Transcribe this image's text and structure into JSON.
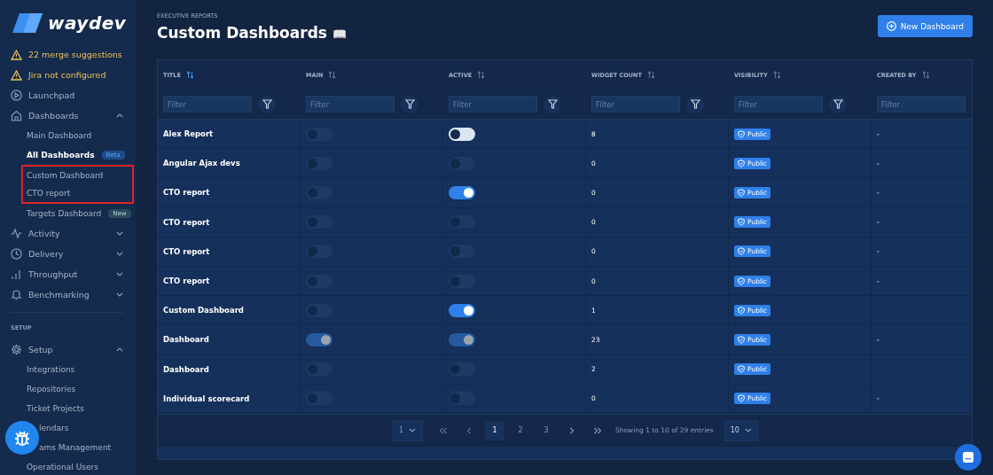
{
  "sidebar": {
    "logo": "waydev",
    "alerts": [
      {
        "label": "22 merge suggestions"
      },
      {
        "label": "Jira not configured"
      }
    ],
    "items": [
      {
        "label": "Launchpad"
      },
      {
        "label": "Dashboards",
        "expanded": true,
        "children": [
          {
            "label": "Main Dashboard",
            "selected": false,
            "highlighted": false
          },
          {
            "label": "All Dashboards",
            "selected": true,
            "highlighted": false,
            "badge": "Beta"
          },
          {
            "label": "Custom Dashboard",
            "selected": false,
            "highlighted": true
          },
          {
            "label": "CTO report",
            "selected": false,
            "highlighted": true
          },
          {
            "label": "Targets Dashboard",
            "selected": false,
            "highlighted": false,
            "badge": "New"
          }
        ]
      },
      {
        "label": "Activity",
        "expanded": false
      },
      {
        "label": "Delivery",
        "expanded": false
      },
      {
        "label": "Throughput",
        "expanded": false
      },
      {
        "label": "Benchmarking",
        "expanded": false
      }
    ],
    "section": "SETUP",
    "setup": {
      "label": "Setup",
      "expanded": true,
      "children": [
        {
          "label": "Integrations",
          "covered": false
        },
        {
          "label": "Repositories",
          "covered": false
        },
        {
          "label": "Ticket Projects",
          "covered": false
        },
        {
          "label": "lendars",
          "covered": true
        },
        {
          "label": "ams Management",
          "covered": true
        },
        {
          "label": "Operational Users",
          "covered": false
        }
      ]
    }
  },
  "header": {
    "breadcrumb": "EXECUTIVE REPORTS",
    "title": "Custom Dashboards",
    "title_emoji": "📖",
    "button": "New Dashboard"
  },
  "table": {
    "columns": [
      {
        "label": "TITLE",
        "sorted": true,
        "filter_placeholder": "Filter"
      },
      {
        "label": "MAIN",
        "sorted": false,
        "filter_placeholder": "Filter"
      },
      {
        "label": "ACTIVE",
        "sorted": false,
        "filter_placeholder": "Filter"
      },
      {
        "label": "WIDGET COUNT",
        "sorted": false,
        "filter_placeholder": "Filter"
      },
      {
        "label": "VISIBILITY",
        "sorted": false,
        "filter_placeholder": "Filter"
      },
      {
        "label": "CREATED BY",
        "sorted": false,
        "filter_placeholder": "Filter"
      }
    ],
    "rows": [
      {
        "title": "Alex Report",
        "main": {
          "on": false,
          "disabled": false,
          "focused": false
        },
        "active": {
          "on": false,
          "disabled": false,
          "focused": true
        },
        "widget_count": "8",
        "visibility": "Public",
        "created_by": "-"
      },
      {
        "title": "Angular Ajax devs",
        "main": {
          "on": false,
          "disabled": false,
          "focused": false
        },
        "active": {
          "on": false,
          "disabled": false,
          "focused": false
        },
        "widget_count": "0",
        "visibility": "Public",
        "created_by": "-"
      },
      {
        "title": "CTO report",
        "main": {
          "on": false,
          "disabled": false,
          "focused": false
        },
        "active": {
          "on": true,
          "disabled": false,
          "focused": false
        },
        "widget_count": "0",
        "visibility": "Public",
        "created_by": "-"
      },
      {
        "title": "CTO report",
        "main": {
          "on": false,
          "disabled": false,
          "focused": false
        },
        "active": {
          "on": false,
          "disabled": false,
          "focused": false
        },
        "widget_count": "0",
        "visibility": "Public",
        "created_by": "-"
      },
      {
        "title": "CTO report",
        "main": {
          "on": false,
          "disabled": false,
          "focused": false
        },
        "active": {
          "on": false,
          "disabled": false,
          "focused": false
        },
        "widget_count": "0",
        "visibility": "Public",
        "created_by": "-"
      },
      {
        "title": "CTO report",
        "main": {
          "on": false,
          "disabled": false,
          "focused": false
        },
        "active": {
          "on": false,
          "disabled": false,
          "focused": false
        },
        "widget_count": "0",
        "visibility": "Public",
        "created_by": "-"
      },
      {
        "title": "Custom Dashboard",
        "main": {
          "on": false,
          "disabled": false,
          "focused": false
        },
        "active": {
          "on": true,
          "disabled": false,
          "focused": false
        },
        "widget_count": "1",
        "visibility": "Public"
      },
      {
        "title": "Dashboard",
        "main": {
          "on": true,
          "disabled": true,
          "focused": false
        },
        "active": {
          "on": true,
          "disabled": true,
          "focused": false
        },
        "widget_count": "23",
        "visibility": "Public",
        "created_by": "-"
      },
      {
        "title": "Dashboard",
        "main": {
          "on": false,
          "disabled": false,
          "focused": false
        },
        "active": {
          "on": false,
          "disabled": false,
          "focused": false
        },
        "widget_count": "2",
        "visibility": "Public"
      },
      {
        "title": "Individual scorecard",
        "main": {
          "on": false,
          "disabled": false,
          "focused": false
        },
        "active": {
          "on": false,
          "disabled": false,
          "focused": false
        },
        "widget_count": "0",
        "visibility": "Public",
        "created_by": "-"
      }
    ]
  },
  "pagination": {
    "jump": "1",
    "pages": [
      {
        "label": "1",
        "selected": true
      },
      {
        "label": "2",
        "selected": false
      },
      {
        "label": "3",
        "selected": false
      }
    ],
    "summary": "Showing 1 to 10 of 29 entries",
    "page_size": "10"
  }
}
